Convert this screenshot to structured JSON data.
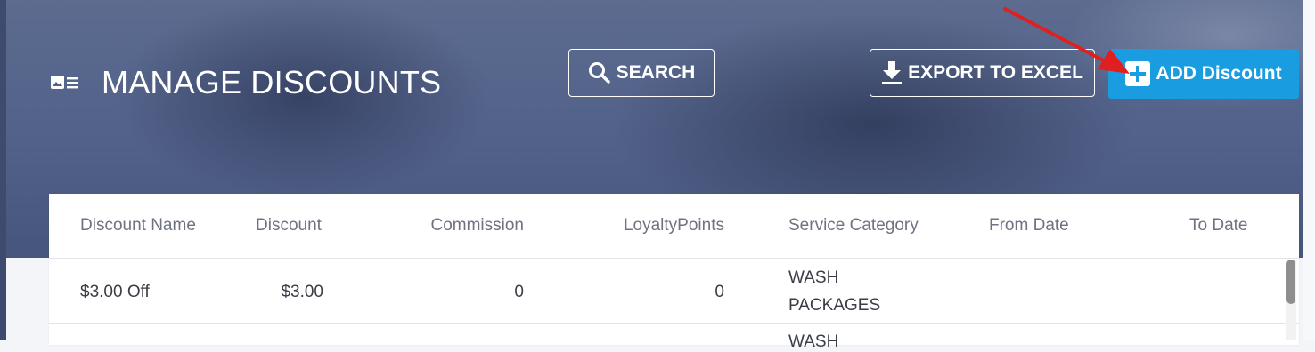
{
  "header": {
    "title": "MANAGE DISCOUNTS",
    "search_label": "SEARCH",
    "export_label": "EXPORT TO EXCEL",
    "add_label": "ADD Discount"
  },
  "colors": {
    "hero": "#52618a",
    "add_button": "#1a9ce0",
    "annotation_arrow": "#e02020"
  },
  "icons": {
    "title": "list-card-icon",
    "search": "search-icon",
    "export": "download-icon",
    "add": "plus-square-icon"
  },
  "table": {
    "columns": [
      "Discount Name",
      "Discount",
      "Commission",
      "LoyaltyPoints",
      "Service Category",
      "From Date",
      "To Date"
    ],
    "rows": [
      {
        "name": "$3.00 Off",
        "discount": "$3.00",
        "commission": "0",
        "loyalty": "0",
        "category_line1": "WASH",
        "category_line2": "PACKAGES",
        "from": "",
        "to": ""
      },
      {
        "category_line1": "WASH"
      }
    ]
  }
}
